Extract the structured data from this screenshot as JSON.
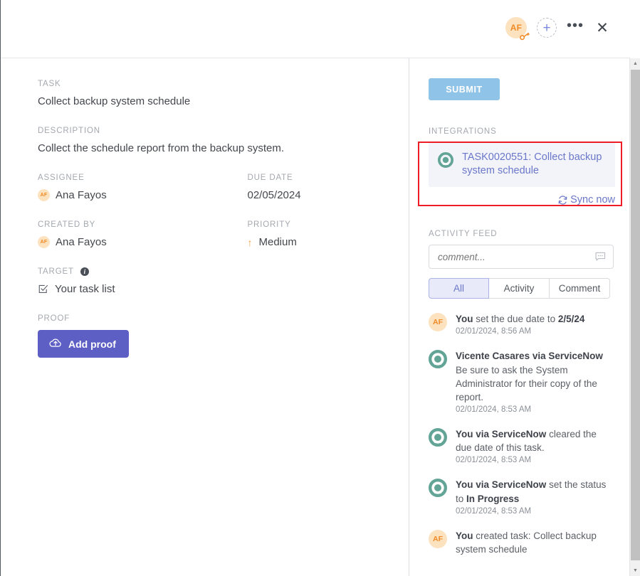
{
  "header": {
    "avatar_initials": "AF",
    "avatar_icon": "key-badge-icon",
    "add_label": "+",
    "more_label": "•••",
    "close_label": "✕"
  },
  "task_detail": {
    "task_label": "TASK",
    "task_value": "Collect backup system schedule",
    "description_label": "DESCRIPTION",
    "description_value": "Collect the schedule report from the backup system.",
    "assignee_label": "ASSIGNEE",
    "assignee_initials": "AF",
    "assignee_value": "Ana Fayos",
    "due_date_label": "DUE DATE",
    "due_date_value": "02/05/2024",
    "created_by_label": "CREATED BY",
    "created_by_initials": "AF",
    "created_by_value": "Ana Fayos",
    "priority_label": "PRIORITY",
    "priority_value": "Medium",
    "priority_arrow": "↑",
    "target_label": "TARGET",
    "target_value": "Your task list",
    "proof_label": "PROOF",
    "add_proof_label": "Add proof"
  },
  "side_panel": {
    "submit_label": "SUBMIT",
    "integrations_label": "INTEGRATIONS",
    "integration_title": "TASK0020551: Collect backup system schedule",
    "sync_label": "Sync now",
    "activity_feed_label": "ACTIVITY FEED",
    "comment_placeholder": "comment...",
    "tabs": [
      {
        "label": "All",
        "active": true
      },
      {
        "label": "Activity",
        "active": false
      },
      {
        "label": "Comment",
        "active": false
      }
    ],
    "feed": [
      {
        "avatar": "AF",
        "avatar_type": "initials",
        "actor": "You",
        "body_before": " set the due date to ",
        "body_bold": "2/5/24",
        "body_after": "",
        "timestamp": "02/01/2024, 8:56 AM"
      },
      {
        "avatar": "servicenow-icon",
        "avatar_type": "servicenow",
        "actor": "Vicente Casares via ServiceNow",
        "body_before": "",
        "body_bold": "",
        "body_after": "Be sure to ask the System Administrator for their copy of the report.",
        "timestamp": "02/01/2024, 8:53 AM"
      },
      {
        "avatar": "servicenow-icon",
        "avatar_type": "servicenow",
        "actor": "You via ServiceNow",
        "body_before": " cleared the due date of this task.",
        "body_bold": "",
        "body_after": "",
        "timestamp": "02/01/2024, 8:53 AM"
      },
      {
        "avatar": "servicenow-icon",
        "avatar_type": "servicenow",
        "actor": "You via ServiceNow",
        "body_before": " set the status to ",
        "body_bold": "In Progress",
        "body_after": "",
        "timestamp": "02/01/2024, 8:53 AM"
      },
      {
        "avatar": "AF",
        "avatar_type": "initials",
        "actor": "You",
        "body_before": " created task: Collect backup system schedule",
        "body_bold": "",
        "body_after": "",
        "timestamp": ""
      }
    ]
  },
  "colors": {
    "accent_purple": "#5d5fc4",
    "submit_blue": "#8fc3e8",
    "highlight_red": "#ee1d25",
    "servicenow_green": "#62a496",
    "avatar_peach": "#fde2c0",
    "link_indigo": "#6a77c9"
  }
}
